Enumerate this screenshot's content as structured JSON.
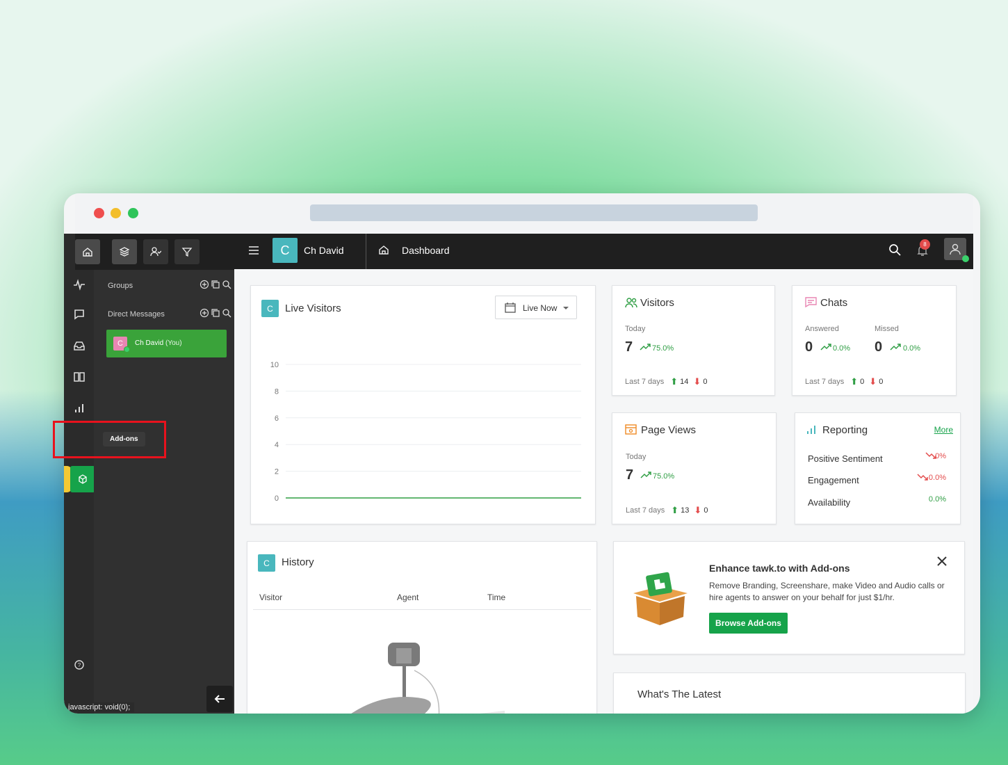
{
  "app": {
    "account_initial": "C",
    "account_name": "Ch David",
    "page_title": "Dashboard",
    "notification_count": "8"
  },
  "panel": {
    "groups_label": "Groups",
    "dm_label": "Direct Messages",
    "dm_user_initial": "C",
    "dm_user_name": "Ch David",
    "dm_user_suffix": "(You)"
  },
  "tooltip": "Add-ons",
  "status_bar": "javascript: void(0);",
  "live_visitors": {
    "badge": "C",
    "title": "Live Visitors",
    "range_label": "Live Now"
  },
  "chart_data": {
    "type": "line",
    "title": "",
    "xlabel": "",
    "ylabel": "",
    "yticks": [
      "10",
      "8",
      "6",
      "4",
      "2",
      "0"
    ],
    "ylim": [
      0,
      10
    ],
    "series": [
      {
        "values": [
          0,
          0
        ]
      }
    ]
  },
  "visitors": {
    "title": "Visitors",
    "today_label": "Today",
    "value": "7",
    "change": "75.0%",
    "last7_label": "Last 7 days",
    "up": "14",
    "down": "0"
  },
  "chats": {
    "title": "Chats",
    "answered_label": "Answered",
    "missed_label": "Missed",
    "answered_value": "0",
    "answered_change": "0.0%",
    "missed_value": "0",
    "missed_change": "0.0%",
    "last7_label": "Last 7 days",
    "up": "0",
    "down": "0"
  },
  "page_views": {
    "title": "Page Views",
    "today_label": "Today",
    "value": "7",
    "change": "75.0%",
    "last7_label": "Last 7 days",
    "up": "13",
    "down": "0"
  },
  "reporting": {
    "title": "Reporting",
    "more": "More",
    "rows": [
      {
        "label": "Positive Sentiment",
        "value": "0%"
      },
      {
        "label": "Engagement",
        "value": "0.0%"
      },
      {
        "label": "Availability",
        "value": "0.0%"
      }
    ]
  },
  "history": {
    "badge": "C",
    "title": "History",
    "columns": [
      "Visitor",
      "Agent",
      "Time"
    ]
  },
  "addons": {
    "title": "Enhance tawk.to with Add-ons",
    "description": "Remove Branding, Screenshare, make Video and Audio calls or hire agents to answer on your behalf for just $1/hr.",
    "button": "Browse Add-ons"
  },
  "latest": {
    "title": "What's The Latest"
  }
}
